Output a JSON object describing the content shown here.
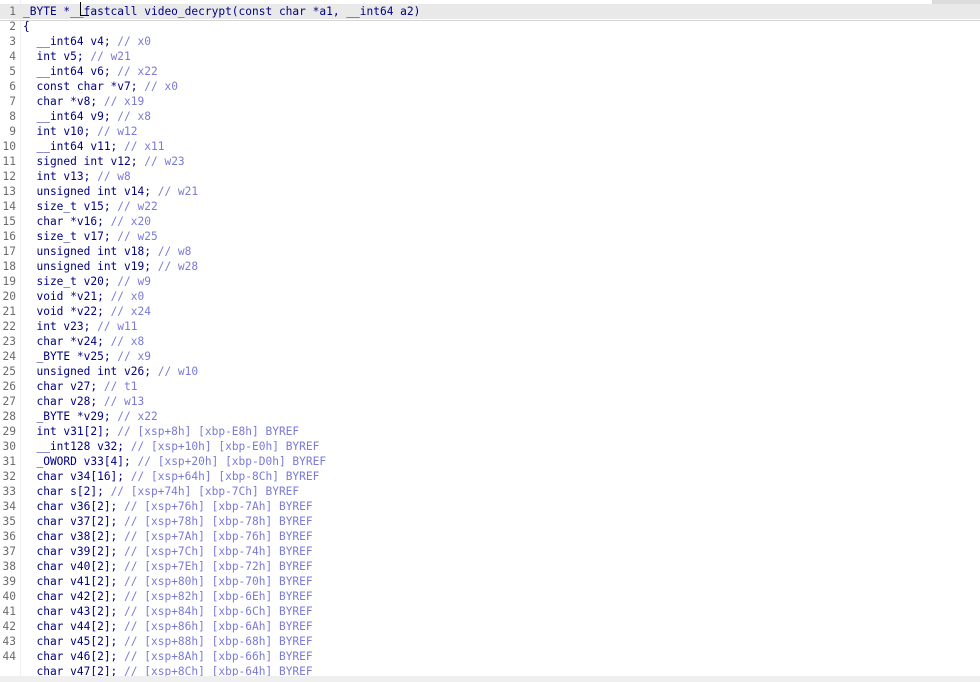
{
  "editor": {
    "lines": [
      {
        "n": "1",
        "code": "_BYTE *__fastcall video_decrypt(const char *a1, __int64 a2)",
        "comment": ""
      },
      {
        "n": "2",
        "code": "{",
        "comment": ""
      },
      {
        "n": "3",
        "code": "  __int64 v4; ",
        "comment": "// x0"
      },
      {
        "n": "4",
        "code": "  int v5; ",
        "comment": "// w21"
      },
      {
        "n": "5",
        "code": "  __int64 v6; ",
        "comment": "// x22"
      },
      {
        "n": "6",
        "code": "  const char *v7; ",
        "comment": "// x0"
      },
      {
        "n": "7",
        "code": "  char *v8; ",
        "comment": "// x19"
      },
      {
        "n": "8",
        "code": "  __int64 v9; ",
        "comment": "// x8"
      },
      {
        "n": "9",
        "code": "  int v10; ",
        "comment": "// w12"
      },
      {
        "n": "10",
        "code": "  __int64 v11; ",
        "comment": "// x11"
      },
      {
        "n": "11",
        "code": "  signed int v12; ",
        "comment": "// w23"
      },
      {
        "n": "12",
        "code": "  int v13; ",
        "comment": "// w8"
      },
      {
        "n": "13",
        "code": "  unsigned int v14; ",
        "comment": "// w21"
      },
      {
        "n": "14",
        "code": "  size_t v15; ",
        "comment": "// w22"
      },
      {
        "n": "15",
        "code": "  char *v16; ",
        "comment": "// x20"
      },
      {
        "n": "16",
        "code": "  size_t v17; ",
        "comment": "// w25"
      },
      {
        "n": "17",
        "code": "  unsigned int v18; ",
        "comment": "// w8"
      },
      {
        "n": "18",
        "code": "  unsigned int v19; ",
        "comment": "// w28"
      },
      {
        "n": "19",
        "code": "  size_t v20; ",
        "comment": "// w9"
      },
      {
        "n": "20",
        "code": "  void *v21; ",
        "comment": "// x0"
      },
      {
        "n": "21",
        "code": "  void *v22; ",
        "comment": "// x24"
      },
      {
        "n": "22",
        "code": "  int v23; ",
        "comment": "// w11"
      },
      {
        "n": "23",
        "code": "  char *v24; ",
        "comment": "// x8"
      },
      {
        "n": "24",
        "code": "  _BYTE *v25; ",
        "comment": "// x9"
      },
      {
        "n": "25",
        "code": "  unsigned int v26; ",
        "comment": "// w10"
      },
      {
        "n": "26",
        "code": "  char v27; ",
        "comment": "// t1"
      },
      {
        "n": "27",
        "code": "  char v28; ",
        "comment": "// w13"
      },
      {
        "n": "28",
        "code": "  _BYTE *v29; ",
        "comment": "// x22"
      },
      {
        "n": "29",
        "code": "  int v31[2]; ",
        "comment": "// [xsp+8h] [xbp-E8h] BYREF"
      },
      {
        "n": "30",
        "code": "  __int128 v32; ",
        "comment": "// [xsp+10h] [xbp-E0h] BYREF"
      },
      {
        "n": "31",
        "code": "  _OWORD v33[4]; ",
        "comment": "// [xsp+20h] [xbp-D0h] BYREF"
      },
      {
        "n": "32",
        "code": "  char v34[16]; ",
        "comment": "// [xsp+64h] [xbp-8Ch] BYREF"
      },
      {
        "n": "33",
        "code": "  char s[2]; ",
        "comment": "// [xsp+74h] [xbp-7Ch] BYREF"
      },
      {
        "n": "34",
        "code": "  char v36[2]; ",
        "comment": "// [xsp+76h] [xbp-7Ah] BYREF"
      },
      {
        "n": "35",
        "code": "  char v37[2]; ",
        "comment": "// [xsp+78h] [xbp-78h] BYREF"
      },
      {
        "n": "36",
        "code": "  char v38[2]; ",
        "comment": "// [xsp+7Ah] [xbp-76h] BYREF"
      },
      {
        "n": "37",
        "code": "  char v39[2]; ",
        "comment": "// [xsp+7Ch] [xbp-74h] BYREF"
      },
      {
        "n": "38",
        "code": "  char v40[2]; ",
        "comment": "// [xsp+7Eh] [xbp-72h] BYREF"
      },
      {
        "n": "39",
        "code": "  char v41[2]; ",
        "comment": "// [xsp+80h] [xbp-70h] BYREF"
      },
      {
        "n": "40",
        "code": "  char v42[2]; ",
        "comment": "// [xsp+82h] [xbp-6Eh] BYREF"
      },
      {
        "n": "41",
        "code": "  char v43[2]; ",
        "comment": "// [xsp+84h] [xbp-6Ch] BYREF"
      },
      {
        "n": "42",
        "code": "  char v44[2]; ",
        "comment": "// [xsp+86h] [xbp-6Ah] BYREF"
      },
      {
        "n": "43",
        "code": "  char v45[2]; ",
        "comment": "// [xsp+88h] [xbp-68h] BYREF"
      },
      {
        "n": "44",
        "code": "  char v46[2]; ",
        "comment": "// [xsp+8Ah] [xbp-66h] BYREF"
      },
      {
        "n": "",
        "code": "  char v47[2]; ",
        "comment": "// [xsp+8Ch] [xbp-64h] BYREF"
      }
    ]
  }
}
